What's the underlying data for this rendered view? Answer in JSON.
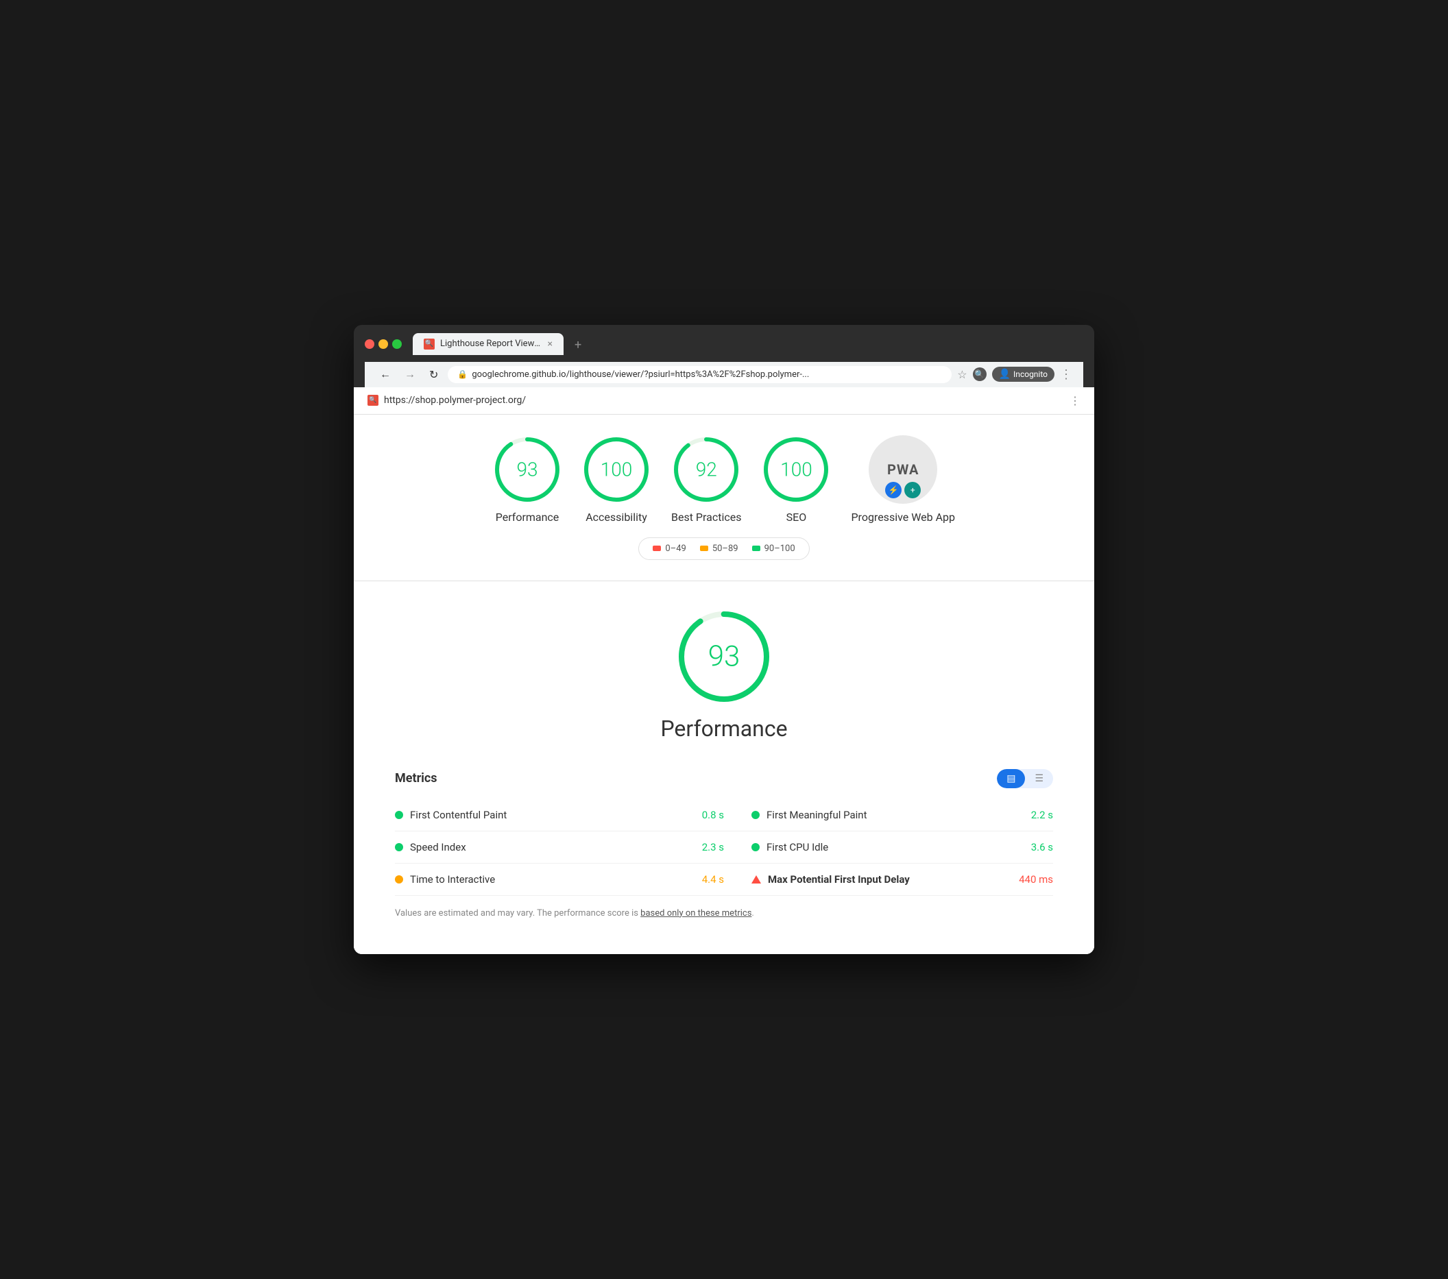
{
  "browser": {
    "tab_label": "Lighthouse Report Viewer",
    "tab_favicon": "🔴",
    "new_tab": "+",
    "close_tab": "×",
    "nav_back": "←",
    "nav_forward": "→",
    "nav_refresh": "↻",
    "address_lock": "🔒",
    "address_url_prefix": "googlechrome.github.io",
    "address_url_full": "googlechrome.github.io/lighthouse/viewer/?psiurl=https%3A%2F%2Fshop.polymer-...",
    "incognito_label": "Incognito",
    "menu_dots": "⋮",
    "page_url": "https://shop.polymer-project.org/"
  },
  "scores": [
    {
      "id": "performance",
      "value": 93,
      "label": "Performance",
      "color": "#0cce6b",
      "dash": 251,
      "gap": 26
    },
    {
      "id": "accessibility",
      "value": 100,
      "label": "Accessibility",
      "color": "#0cce6b",
      "dash": 277,
      "gap": 0
    },
    {
      "id": "best-practices",
      "value": 92,
      "label": "Best Practices",
      "color": "#0cce6b",
      "dash": 248,
      "gap": 29
    },
    {
      "id": "seo",
      "value": 100,
      "label": "SEO",
      "color": "#0cce6b",
      "dash": 277,
      "gap": 0
    }
  ],
  "pwa": {
    "label": "Progressive Web App",
    "text": "PWA",
    "badge1": "⚡",
    "badge2": "+"
  },
  "legend": {
    "ranges": [
      {
        "label": "0–49",
        "color_class": "dot-red"
      },
      {
        "label": "50–89",
        "color_class": "dot-orange"
      },
      {
        "label": "90–100",
        "color_class": "dot-green"
      }
    ]
  },
  "performance": {
    "score": 93,
    "title": "Performance"
  },
  "metrics": {
    "title": "Metrics",
    "toggle_view1": "≡",
    "toggle_view2": "≡",
    "items": [
      {
        "name": "First Contentful Paint",
        "value": "0.8 s",
        "value_color": "value-green",
        "indicator": "indicator-green"
      },
      {
        "name": "First Meaningful Paint",
        "value": "2.2 s",
        "value_color": "value-green",
        "indicator": "indicator-green"
      },
      {
        "name": "Speed Index",
        "value": "2.3 s",
        "value_color": "value-green",
        "indicator": "indicator-green"
      },
      {
        "name": "First CPU Idle",
        "value": "3.6 s",
        "value_color": "value-green",
        "indicator": "indicator-green"
      },
      {
        "name": "Time to Interactive",
        "value": "4.4 s",
        "value_color": "value-orange",
        "indicator": "indicator-orange"
      },
      {
        "name": "Max Potential First Input Delay",
        "value": "440 ms",
        "value_color": "value-red",
        "indicator": "indicator-triangle"
      }
    ],
    "footer_text": "Values are estimated and may vary. The performance score is ",
    "footer_link": "based only on these metrics",
    "footer_end": "."
  }
}
